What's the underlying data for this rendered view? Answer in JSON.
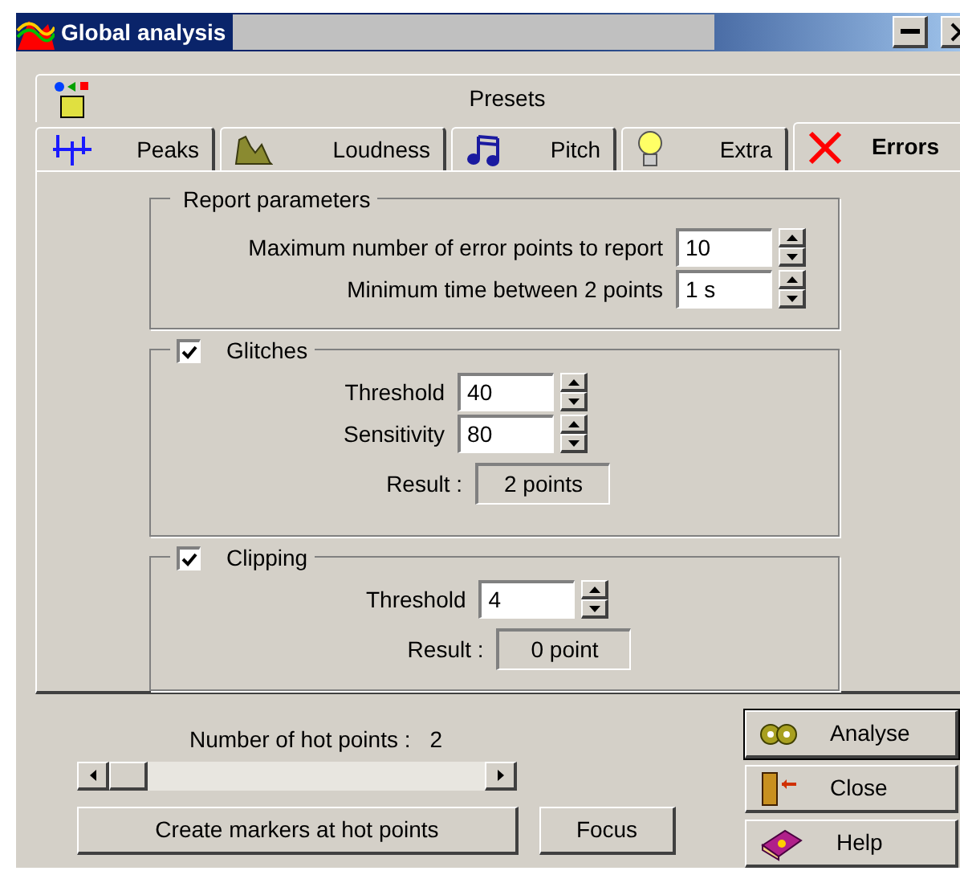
{
  "window": {
    "title": "Global analysis"
  },
  "preset_tabs": [
    {
      "label": "Presets",
      "selected": false
    }
  ],
  "tabs": [
    {
      "label": "Peaks",
      "kind": "peaks",
      "selected": false
    },
    {
      "label": "Loudness",
      "kind": "loudness",
      "selected": false
    },
    {
      "label": "Pitch",
      "kind": "pitch",
      "selected": false
    },
    {
      "label": "Extra",
      "kind": "extra",
      "selected": false
    },
    {
      "label": "Errors",
      "kind": "errors",
      "selected": true
    }
  ],
  "report_parameters": {
    "title": "Report parameters",
    "fields": [
      {
        "label": "Maximum number of error points to report",
        "value": "10"
      },
      {
        "label": "Minimum time between 2 points",
        "value": "1 s"
      }
    ]
  },
  "glitches": {
    "title": "Glitches",
    "checked": true,
    "fields": [
      {
        "label": "Threshold",
        "value": "40"
      },
      {
        "label": "Sensitivity",
        "value": "80"
      }
    ],
    "result_label": "Result :",
    "result": "2 points"
  },
  "clipping": {
    "title": "Clipping",
    "checked": true,
    "fields": [
      {
        "label": "Threshold",
        "value": "4"
      }
    ],
    "result_label": "Result :",
    "result": "0 point"
  },
  "hot_points": {
    "label": "Number of hot points :",
    "value": "2"
  },
  "buttons": [
    {
      "label": "Create markers at hot points",
      "kind": "markers"
    },
    {
      "label": "Focus",
      "kind": "focus"
    }
  ],
  "side_buttons": [
    {
      "label": "Analyse",
      "kind": "analyse",
      "default": true
    },
    {
      "label": "Close",
      "kind": "close",
      "default": false
    },
    {
      "label": "Help",
      "kind": "help",
      "default": false
    }
  ]
}
